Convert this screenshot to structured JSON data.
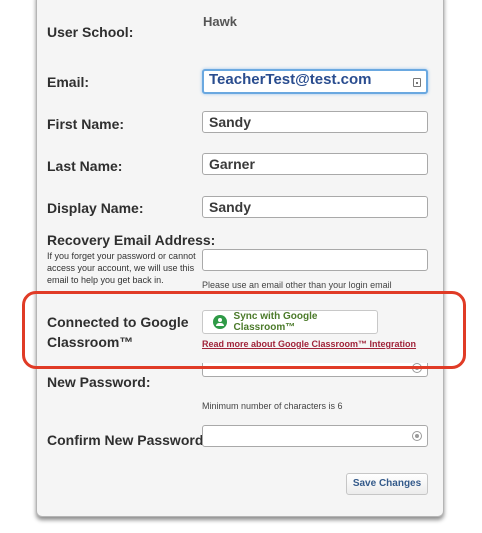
{
  "form": {
    "school": {
      "label": "User School:",
      "value": "Hawk"
    },
    "email": {
      "label": "Email:",
      "value": "TeacherTest@test.com"
    },
    "first_name": {
      "label": "First Name:",
      "value": "Sandy"
    },
    "last_name": {
      "label": "Last Name:",
      "value": "Garner"
    },
    "display_name": {
      "label": "Display Name:",
      "value": "Sandy"
    },
    "recovery": {
      "label": "Recovery Email Address:",
      "help": "If you forget your password or cannot access your account, we will use this email to help you get back in.",
      "value": "",
      "hint": "Please use an email other than your login email"
    },
    "google": {
      "label_line1": "Connected to Google",
      "label_line2": "Classroom™",
      "button_label": "Sync with Google Classroom™",
      "link_label": "Read more about Google Classroom™ Integration"
    },
    "new_password": {
      "label": "New Password:",
      "value": "",
      "hint": "Minimum number of characters is 6"
    },
    "confirm_password": {
      "label": "Confirm New Password:",
      "value": ""
    },
    "save_label": "Save Changes"
  },
  "colors": {
    "panel_bg": "#f5f5f5",
    "focus_border": "#6aa8e0",
    "highlight": "#e03b26",
    "google_green": "#2f9a47",
    "link": "#a0243a"
  },
  "icons": {
    "email_field": "contact-card-icon",
    "password_field": "password-reveal-icon",
    "google": "google-classroom-icon"
  }
}
